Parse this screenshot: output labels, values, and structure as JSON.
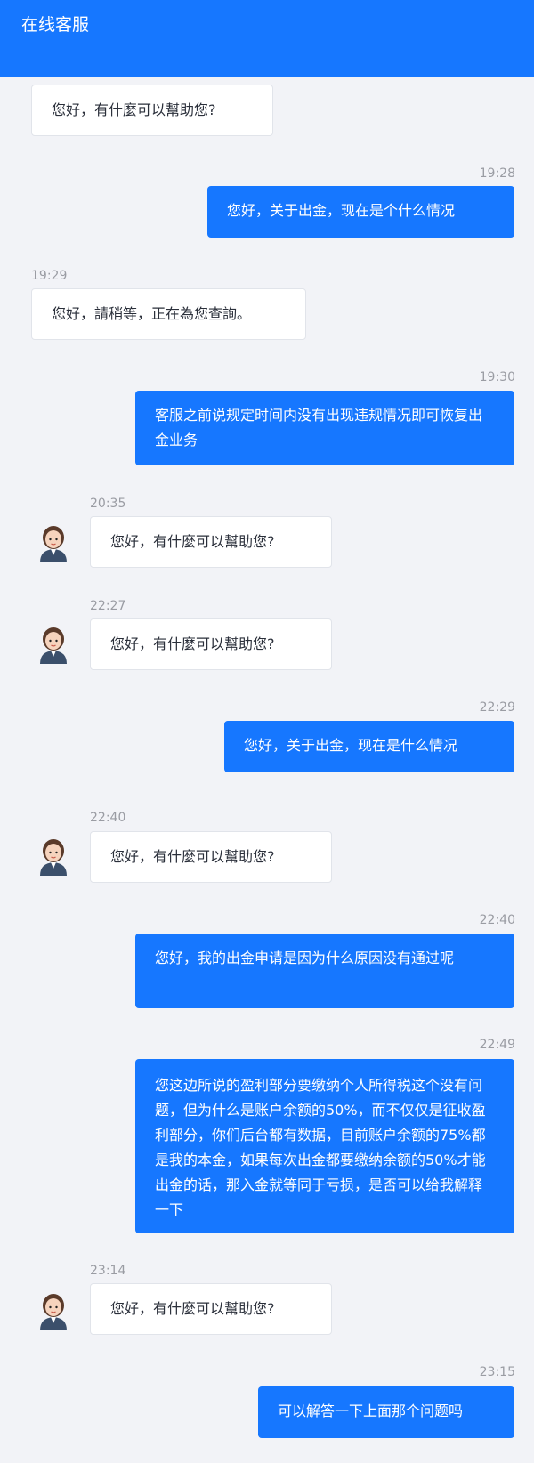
{
  "header": {
    "title": "在线客服"
  },
  "messages": [
    {
      "side": "in",
      "time": "",
      "avatar": false,
      "text": "您好，有什麼可以幫助您?"
    },
    {
      "side": "out",
      "time": "19:28",
      "text": "您好，关于出金，现在是个什么情况"
    },
    {
      "side": "in",
      "time": "19:29",
      "avatar": false,
      "text": "您好，請稍等，正在為您查詢。"
    },
    {
      "side": "out",
      "time": "19:30",
      "text": "客服之前说规定时间内没有出现违规情况即可恢复出金业务"
    },
    {
      "side": "in",
      "time": "20:35",
      "avatar": true,
      "text": "您好，有什麼可以幫助您?"
    },
    {
      "side": "in",
      "time": "22:27",
      "avatar": true,
      "text": "您好，有什麼可以幫助您?"
    },
    {
      "side": "out",
      "time": "22:29",
      "text": "您好，关于出金，现在是什么情况"
    },
    {
      "side": "in",
      "time": "22:40",
      "avatar": true,
      "text": "您好，有什麼可以幫助您?"
    },
    {
      "side": "out",
      "time": "22:40",
      "text": "您好，我的出金申请是因为什么原因没有通过呢"
    },
    {
      "side": "out",
      "time": "22:49",
      "text": "您这边所说的盈利部分要缴纳个人所得税这个没有问题，但为什么是账户余额的50%，而不仅仅是征收盈利部分，你们后台都有数据，目前账户余额的75%都是我的本金，如果每次出金都要缴纳余额的50%才能出金的话，那入金就等同于亏损，是否可以给我解释一下"
    },
    {
      "side": "in",
      "time": "23:14",
      "avatar": true,
      "text": "您好，有什麼可以幫助您?"
    },
    {
      "side": "out",
      "time": "23:15",
      "text": "可以解答一下上面那个问题吗"
    }
  ]
}
